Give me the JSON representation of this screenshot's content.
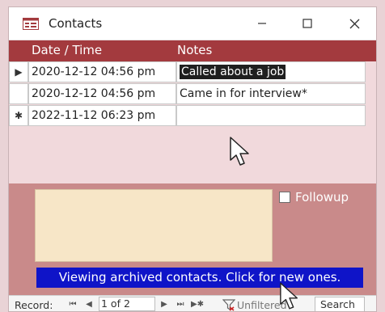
{
  "window": {
    "title": "Contacts"
  },
  "grid": {
    "columns": [
      "Date / Time",
      "Notes"
    ],
    "rows": [
      {
        "date": "2020-12-12 04:56 pm",
        "notes": "Called about a job"
      },
      {
        "date": "2020-12-12 04:56 pm",
        "notes": "Came in for interview*"
      },
      {
        "date": "2022-11-12 06:23 pm",
        "notes": ""
      }
    ]
  },
  "detail": {
    "followup_label": "Followup",
    "banner": "Viewing archived contacts. Click for new ones."
  },
  "navigation": {
    "record_label": "Record:",
    "position": "1 of 2",
    "filter_label": "Unfiltered",
    "search_placeholder": "Search"
  },
  "colors": {
    "header": "#a33a3e",
    "detail_bg": "#c98a8a",
    "banner_bg": "#0f14c8",
    "memo_bg": "#f7e6c7"
  }
}
